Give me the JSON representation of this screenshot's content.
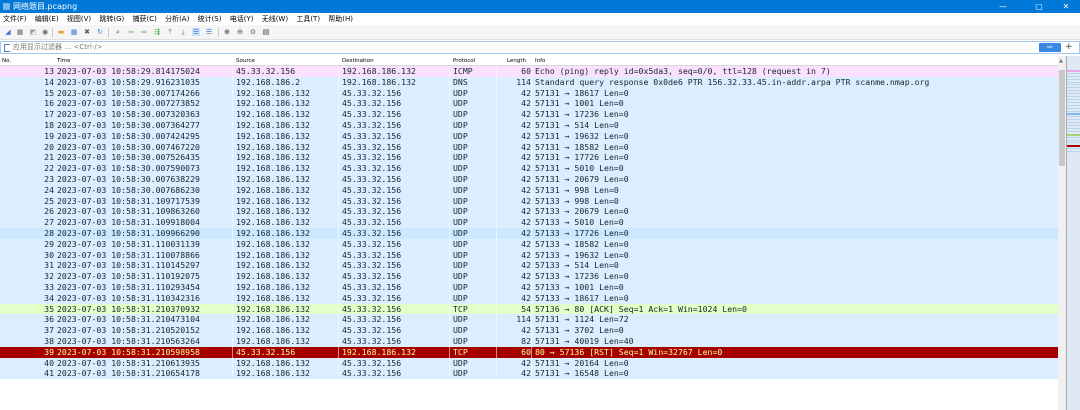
{
  "window": {
    "title": "网络题目.pcapng",
    "minimize": "—",
    "maximize": "▢",
    "close": "✕"
  },
  "menu": [
    "文件(F)",
    "编辑(E)",
    "视图(V)",
    "跳转(G)",
    "捕获(C)",
    "分析(A)",
    "统计(S)",
    "电话(Y)",
    "无线(W)",
    "工具(T)",
    "帮助(H)"
  ],
  "toolbar_icons": [
    "start-capture-icon",
    "stop-capture-icon",
    "restart-capture-icon",
    "capture-options-icon",
    "open-file-icon",
    "save-file-icon",
    "close-file-icon",
    "reload-icon",
    "find-packet-icon",
    "go-back-icon",
    "go-forward-icon",
    "go-to-packet-icon",
    "go-first-icon",
    "go-last-icon",
    "autoscroll-icon",
    "colorize-icon",
    "zoom-in-icon",
    "zoom-out-icon",
    "zoom-normal-icon",
    "resize-columns-icon"
  ],
  "filter": {
    "placeholder": "应用显示过滤器 … <Ctrl-/>",
    "apply": "⇨",
    "add": "+"
  },
  "columns": [
    "No.",
    "Time",
    "Source",
    "Destination",
    "Protocol",
    "Length",
    "Info"
  ],
  "colors": {
    "udp": "#daeeff",
    "icmp": "#fce0ff",
    "tcp": "#e7e6ff",
    "ack": "#e4ffc7",
    "rst_bg": "#a40000",
    "rst_fg": "#fffc9c",
    "selected": "#cce8ff"
  },
  "packets": [
    {
      "no": "13",
      "time": "2023-07-03 10:58:29.814175024",
      "src": "45.33.32.156",
      "dst": "192.168.186.132",
      "proto": "ICMP",
      "len": "60",
      "info": "Echo (ping) reply    id=0x5da3, seq=0/0, ttl=128 (request in 7)",
      "style": "icmp"
    },
    {
      "no": "14",
      "time": "2023-07-03 10:58:29.916231035",
      "src": "192.168.186.2",
      "dst": "192.168.186.132",
      "proto": "DNS",
      "len": "114",
      "info": "Standard query response 0x0de6 PTR 156.32.33.45.in-addr.arpa PTR scanme.nmap.org",
      "style": "udp"
    },
    {
      "no": "15",
      "time": "2023-07-03 10:58:30.007174266",
      "src": "192.168.186.132",
      "dst": "45.33.32.156",
      "proto": "UDP",
      "len": "42",
      "info": "57131 → 18617 Len=0",
      "style": "udp"
    },
    {
      "no": "16",
      "time": "2023-07-03 10:58:30.007273852",
      "src": "192.168.186.132",
      "dst": "45.33.32.156",
      "proto": "UDP",
      "len": "42",
      "info": "57131 → 1001 Len=0",
      "style": "udp"
    },
    {
      "no": "17",
      "time": "2023-07-03 10:58:30.007320363",
      "src": "192.168.186.132",
      "dst": "45.33.32.156",
      "proto": "UDP",
      "len": "42",
      "info": "57131 → 17236 Len=0",
      "style": "udp"
    },
    {
      "no": "18",
      "time": "2023-07-03 10:58:30.007364277",
      "src": "192.168.186.132",
      "dst": "45.33.32.156",
      "proto": "UDP",
      "len": "42",
      "info": "57131 → 514 Len=0",
      "style": "udp"
    },
    {
      "no": "19",
      "time": "2023-07-03 10:58:30.007424295",
      "src": "192.168.186.132",
      "dst": "45.33.32.156",
      "proto": "UDP",
      "len": "42",
      "info": "57131 → 19632 Len=0",
      "style": "udp"
    },
    {
      "no": "20",
      "time": "2023-07-03 10:58:30.007467220",
      "src": "192.168.186.132",
      "dst": "45.33.32.156",
      "proto": "UDP",
      "len": "42",
      "info": "57131 → 18582 Len=0",
      "style": "udp"
    },
    {
      "no": "21",
      "time": "2023-07-03 10:58:30.007526435",
      "src": "192.168.186.132",
      "dst": "45.33.32.156",
      "proto": "UDP",
      "len": "42",
      "info": "57131 → 17726 Len=0",
      "style": "udp"
    },
    {
      "no": "22",
      "time": "2023-07-03 10:58:30.007590073",
      "src": "192.168.186.132",
      "dst": "45.33.32.156",
      "proto": "UDP",
      "len": "42",
      "info": "57131 → 5010 Len=0",
      "style": "udp"
    },
    {
      "no": "23",
      "time": "2023-07-03 10:58:30.007638229",
      "src": "192.168.186.132",
      "dst": "45.33.32.156",
      "proto": "UDP",
      "len": "42",
      "info": "57131 → 20679 Len=0",
      "style": "udp"
    },
    {
      "no": "24",
      "time": "2023-07-03 10:58:30.007686230",
      "src": "192.168.186.132",
      "dst": "45.33.32.156",
      "proto": "UDP",
      "len": "42",
      "info": "57131 → 998 Len=0",
      "style": "udp"
    },
    {
      "no": "25",
      "time": "2023-07-03 10:58:31.109717539",
      "src": "192.168.186.132",
      "dst": "45.33.32.156",
      "proto": "UDP",
      "len": "42",
      "info": "57133 → 998 Len=0",
      "style": "udp"
    },
    {
      "no": "26",
      "time": "2023-07-03 10:58:31.109863260",
      "src": "192.168.186.132",
      "dst": "45.33.32.156",
      "proto": "UDP",
      "len": "42",
      "info": "57133 → 20679 Len=0",
      "style": "udp"
    },
    {
      "no": "27",
      "time": "2023-07-03 10:58:31.109918004",
      "src": "192.168.186.132",
      "dst": "45.33.32.156",
      "proto": "UDP",
      "len": "42",
      "info": "57133 → 5010 Len=0",
      "style": "udp"
    },
    {
      "no": "28",
      "time": "2023-07-03 10:58:31.109966290",
      "src": "192.168.186.132",
      "dst": "45.33.32.156",
      "proto": "UDP",
      "len": "42",
      "info": "57133 → 17726 Len=0",
      "style": "selected"
    },
    {
      "no": "29",
      "time": "2023-07-03 10:58:31.110031139",
      "src": "192.168.186.132",
      "dst": "45.33.32.156",
      "proto": "UDP",
      "len": "42",
      "info": "57133 → 18582 Len=0",
      "style": "udp"
    },
    {
      "no": "30",
      "time": "2023-07-03 10:58:31.110078866",
      "src": "192.168.186.132",
      "dst": "45.33.32.156",
      "proto": "UDP",
      "len": "42",
      "info": "57133 → 19632 Len=0",
      "style": "udp"
    },
    {
      "no": "31",
      "time": "2023-07-03 10:58:31.110145297",
      "src": "192.168.186.132",
      "dst": "45.33.32.156",
      "proto": "UDP",
      "len": "42",
      "info": "57133 → 514 Len=0",
      "style": "udp"
    },
    {
      "no": "32",
      "time": "2023-07-03 10:58:31.110192075",
      "src": "192.168.186.132",
      "dst": "45.33.32.156",
      "proto": "UDP",
      "len": "42",
      "info": "57133 → 17236 Len=0",
      "style": "udp"
    },
    {
      "no": "33",
      "time": "2023-07-03 10:58:31.110293454",
      "src": "192.168.186.132",
      "dst": "45.33.32.156",
      "proto": "UDP",
      "len": "42",
      "info": "57133 → 1001 Len=0",
      "style": "udp"
    },
    {
      "no": "34",
      "time": "2023-07-03 10:58:31.110342316",
      "src": "192.168.186.132",
      "dst": "45.33.32.156",
      "proto": "UDP",
      "len": "42",
      "info": "57133 → 18617 Len=0",
      "style": "udp"
    },
    {
      "no": "35",
      "time": "2023-07-03 10:58:31.210370932",
      "src": "192.168.186.132",
      "dst": "45.33.32.156",
      "proto": "TCP",
      "len": "54",
      "info": "57136 → 80 [ACK] Seq=1 Ack=1 Win=1024 Len=0",
      "style": "ack"
    },
    {
      "no": "36",
      "time": "2023-07-03 10:58:31.210473104",
      "src": "192.168.186.132",
      "dst": "45.33.32.156",
      "proto": "UDP",
      "len": "114",
      "info": "57131 → 1124 Len=72",
      "style": "udp"
    },
    {
      "no": "37",
      "time": "2023-07-03 10:58:31.210520152",
      "src": "192.168.186.132",
      "dst": "45.33.32.156",
      "proto": "UDP",
      "len": "42",
      "info": "57131 → 3702 Len=0",
      "style": "udp"
    },
    {
      "no": "38",
      "time": "2023-07-03 10:58:31.210563264",
      "src": "192.168.186.132",
      "dst": "45.33.32.156",
      "proto": "UDP",
      "len": "82",
      "info": "57131 → 40019 Len=40",
      "style": "udp"
    },
    {
      "no": "39",
      "time": "2023-07-03 10:58:31.210598958",
      "src": "45.33.32.156",
      "dst": "192.168.186.132",
      "proto": "TCP",
      "len": "60",
      "info": "80 → 57136 [RST] Seq=1 Win=32767 Len=0",
      "style": "rst"
    },
    {
      "no": "40",
      "time": "2023-07-03 10:58:31.210613935",
      "src": "192.168.186.132",
      "dst": "45.33.32.156",
      "proto": "UDP",
      "len": "42",
      "info": "57131 → 20164 Len=0",
      "style": "udp"
    },
    {
      "no": "41",
      "time": "2023-07-03 10:58:31.210654178",
      "src": "192.168.186.132",
      "dst": "45.33.32.156",
      "proto": "UDP",
      "len": "42",
      "info": "57131 → 16548 Len=0",
      "style": "udp"
    }
  ]
}
